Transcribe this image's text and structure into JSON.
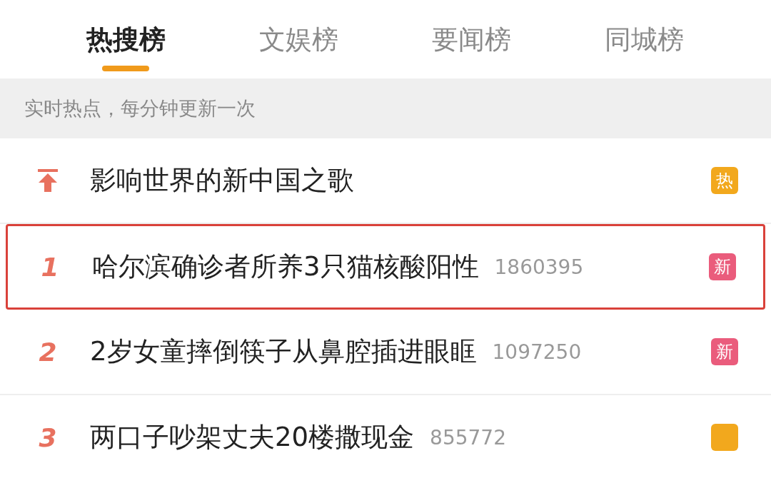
{
  "tabs": [
    {
      "label": "热搜榜",
      "selected": true
    },
    {
      "label": "文娱榜",
      "selected": false
    },
    {
      "label": "要闻榜",
      "selected": false
    },
    {
      "label": "同城榜",
      "selected": false
    }
  ],
  "notice": "实时热点，每分钟更新一次",
  "rows": [
    {
      "kind": "pinned",
      "title": "影响世界的新中国之歌",
      "highlighted": false,
      "badge": {
        "label": "热",
        "color": "#f2a81d"
      }
    },
    {
      "kind": "ranked",
      "rank": "1",
      "title": "哈尔滨确诊者所养3只猫核酸阳性",
      "count": "1860395",
      "highlighted": true,
      "badge": {
        "label": "新",
        "color": "#ea5c7c"
      }
    },
    {
      "kind": "ranked",
      "rank": "2",
      "title": "2岁女童摔倒筷子从鼻腔插进眼眶",
      "count": "1097250",
      "highlighted": false,
      "badge": {
        "label": "新",
        "color": "#ea5c7c"
      }
    },
    {
      "kind": "ranked",
      "rank": "3",
      "title": "两口子吵架丈夫20楼撒现金",
      "count": "855772",
      "highlighted": false,
      "badge": {
        "color": "#f2a81d"
      }
    }
  ]
}
